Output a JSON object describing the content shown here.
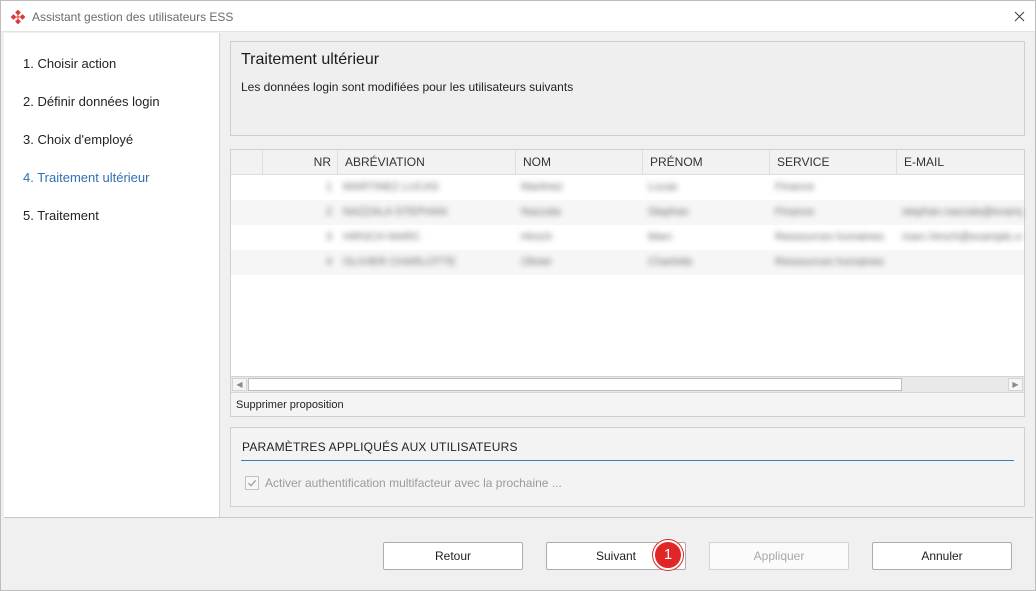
{
  "window": {
    "title": "Assistant gestion des utilisateurs ESS"
  },
  "sidebar": {
    "steps": [
      {
        "label": "1. Choisir action"
      },
      {
        "label": "2. Définir données login"
      },
      {
        "label": "3. Choix d'employé"
      },
      {
        "label": "4. Traitement ultérieur",
        "active": true
      },
      {
        "label": "5. Traitement"
      }
    ]
  },
  "header": {
    "title": "Traitement ultérieur",
    "description": "Les données login sont modifiées pour les utilisateurs suivants"
  },
  "grid": {
    "columns": [
      "",
      "NR",
      "ABRÉVIATION",
      "NOM",
      "PRÉNOM",
      "SERVICE",
      "E-MAIL"
    ],
    "rows": [
      [
        "",
        "1",
        "MARTINEZ LUCAS",
        "Martinez",
        "Lucas",
        "Finance",
        ""
      ],
      [
        "",
        "2",
        "NAZZALA STEPHAN",
        "Nazzala",
        "Stephan",
        "Finance",
        "stephan.nazzala@example.com"
      ],
      [
        "",
        "3",
        "HIRSCH MARC",
        "Hirsch",
        "Marc",
        "Ressources humaines",
        "marc.hirsch@example.com"
      ],
      [
        "",
        "4",
        "OLIVIER CHARLOTTE",
        "Olivier",
        "Charlotte",
        "Ressources humaines",
        ""
      ]
    ],
    "footer_link": "Supprimer proposition"
  },
  "params": {
    "title": "PARAMÈTRES APPLIQUÉS AUX UTILISATEURS",
    "mfa_label": "Activer authentification multifacteur avec la prochaine ..."
  },
  "buttons": {
    "back": "Retour",
    "next": "Suivant",
    "apply": "Appliquer",
    "cancel": "Annuler"
  },
  "badge": {
    "text": "1"
  },
  "colors": {
    "accent": "#2f6fb3",
    "badge": "#e02626"
  }
}
